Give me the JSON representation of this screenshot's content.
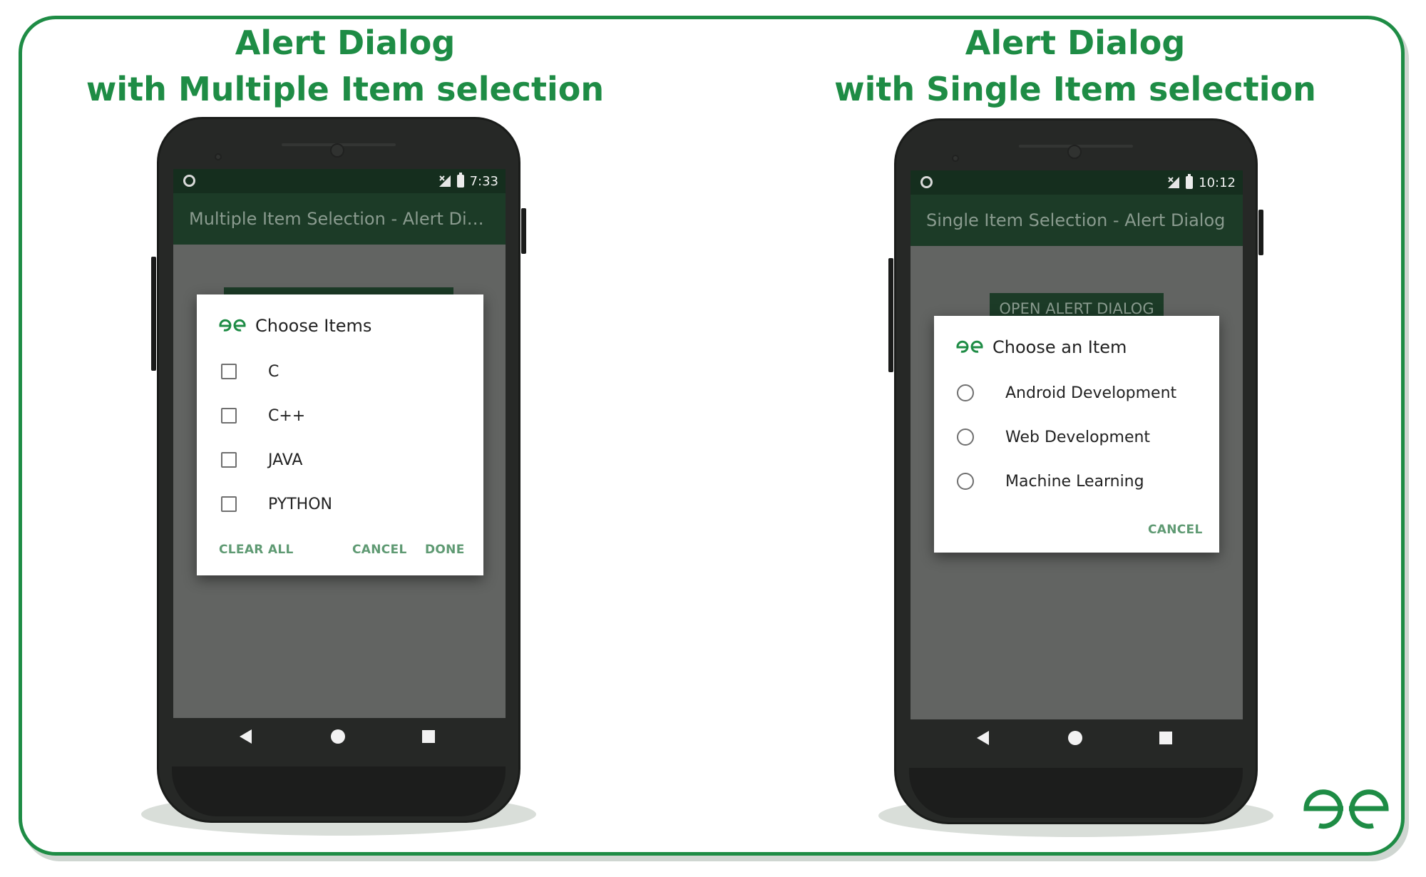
{
  "left_panel": {
    "heading_line1": "Alert Dialog",
    "heading_line2": "with Multiple Item selection",
    "status_time": "7:33",
    "app_title": "Multiple Item Selection - Alert Dial...",
    "dialog": {
      "title": "Choose Items",
      "options": [
        "C",
        "C++",
        "JAVA",
        "PYTHON"
      ],
      "clear_all_label": "CLEAR ALL",
      "cancel_label": "CANCEL",
      "done_label": "DONE"
    }
  },
  "right_panel": {
    "heading_line1": "Alert Dialog",
    "heading_line2": "with Single Item selection",
    "status_time": "10:12",
    "app_title": "Single Item Selection - Alert Dialog",
    "open_button_label": "OPEN ALERT DIALOG",
    "dialog": {
      "title": "Choose an Item",
      "options": [
        "Android Development",
        "Web Development",
        "Machine Learning"
      ],
      "cancel_label": "CANCEL"
    }
  },
  "icons": {
    "dialog_icon": "gfg-logo-icon",
    "status_signal": "no-signal-icon",
    "status_battery": "battery-icon",
    "nav_back": "back-triangle-icon",
    "nav_home": "home-circle-icon",
    "nav_recent": "recent-square-icon",
    "brand": "gfg-logo-icon"
  },
  "colors": {
    "brand_green": "#1e8c45",
    "appbar": "#1c3b27",
    "statusbar": "#152e1e",
    "dialog_button_text": "#5f9a73"
  }
}
